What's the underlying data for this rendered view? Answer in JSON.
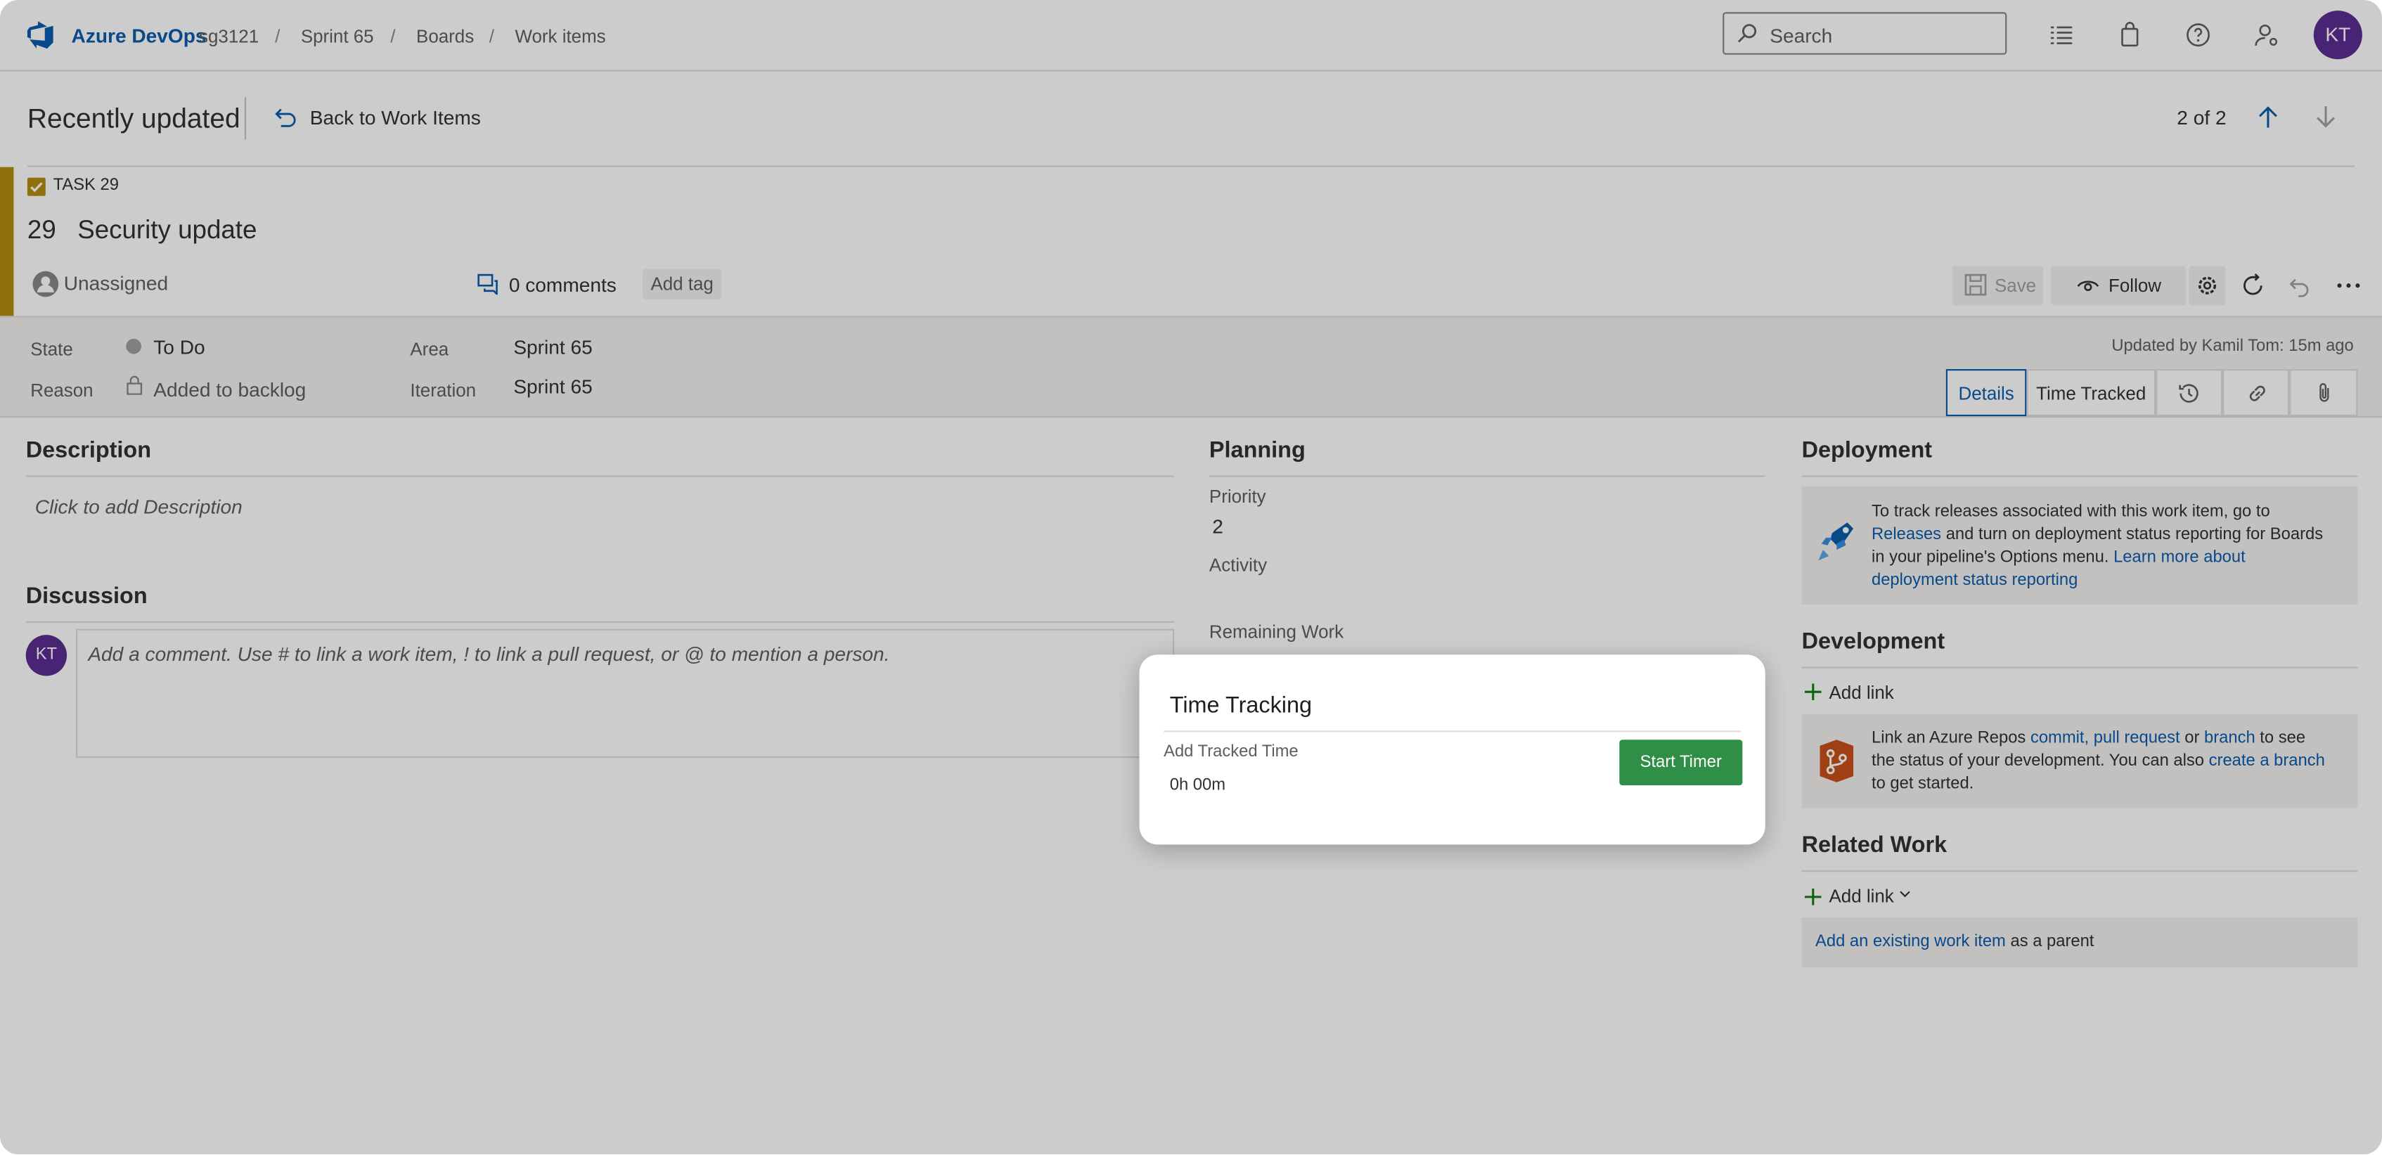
{
  "header": {
    "brand": "Azure DevOps",
    "breadcrumb": [
      "sg3121",
      "Sprint 65",
      "Boards",
      "Work items"
    ],
    "search_placeholder": "Search",
    "avatar": "KT"
  },
  "subheader": {
    "title": "Recently updated",
    "back": "Back to Work Items",
    "pager": "2 of 2"
  },
  "workitem": {
    "type": "TASK 29",
    "id": "29",
    "title": "Security update",
    "assignee": "Unassigned",
    "comments": "0 comments",
    "add_tag": "Add tag",
    "save": "Save",
    "follow": "Follow",
    "accent_color": "#b58d0f"
  },
  "fields": {
    "state_label": "State",
    "state": "To Do",
    "reason_label": "Reason",
    "reason": "Added to backlog",
    "area_label": "Area",
    "area": "Sprint 65",
    "iteration_label": "Iteration",
    "iteration": "Sprint 65",
    "updated_by": "Updated by Kamil Tom: 15m ago"
  },
  "tabs": {
    "details": "Details",
    "time_tracked": "Time Tracked"
  },
  "description": {
    "title": "Description",
    "placeholder": "Click to add Description"
  },
  "discussion": {
    "title": "Discussion",
    "avatar": "KT",
    "placeholder": "Add a comment. Use # to link a work item, ! to link a pull request, or @ to mention a person."
  },
  "planning": {
    "title": "Planning",
    "priority_label": "Priority",
    "priority": "2",
    "activity_label": "Activity",
    "remaining_label": "Remaining Work"
  },
  "deployment": {
    "title": "Deployment",
    "t1": "To track releases associated with this work item, go to",
    "releases": "Releases",
    "t2": "and turn on deployment status reporting for Boards",
    "t3": "in your pipeline's Options menu.",
    "learn1": "Learn more about",
    "learn2": "deployment status reporting"
  },
  "development": {
    "title": "Development",
    "add_link": "Add link",
    "t1": "Link an Azure Repos",
    "commit": "commit,",
    "pull_request": "pull request",
    "or": "or",
    "branch": "branch",
    "t2": "to see",
    "t3": "the status of your development. You can also",
    "create_branch": "create a branch",
    "t4": "to get started."
  },
  "related": {
    "title": "Related Work",
    "add_link": "Add link",
    "existing": "Add an existing work item",
    "as_parent": "as a parent"
  },
  "dialog": {
    "title": "Time Tracking",
    "label": "Add Tracked Time",
    "value": "0h 00m",
    "button": "Start Timer",
    "button_color": "#2f8f46"
  }
}
